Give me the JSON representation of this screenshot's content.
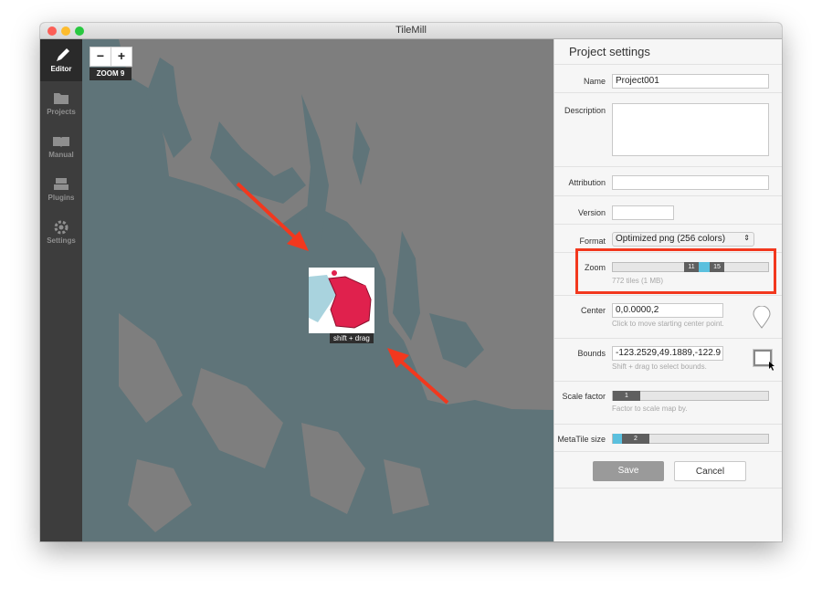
{
  "window": {
    "title": "TileMill"
  },
  "sidebar": {
    "items": [
      {
        "label": "Editor",
        "icon": "pencil-icon",
        "active": true
      },
      {
        "label": "Projects",
        "icon": "folder-icon"
      },
      {
        "label": "Manual",
        "icon": "book-icon"
      },
      {
        "label": "Plugins",
        "icon": "plugin-icon"
      },
      {
        "label": "Settings",
        "icon": "gear-icon"
      }
    ]
  },
  "map": {
    "zoom_out": "−",
    "zoom_in": "+",
    "zoom_label": "ZOOM 9",
    "drag_tooltip": "shift + drag"
  },
  "panel": {
    "title": "Project settings",
    "name_label": "Name",
    "name_value": "Project001",
    "description_label": "Description",
    "description_value": "",
    "attribution_label": "Attribution",
    "attribution_value": "",
    "version_label": "Version",
    "version_value": "",
    "format_label": "Format",
    "format_value": "Optimized png (256 colors)",
    "zoom_label": "Zoom",
    "zoom_min": "11",
    "zoom_max": "15",
    "zoom_hint": "772 tiles (1 MB)",
    "center_label": "Center",
    "center_value": "0,0.0000,2",
    "center_hint": "Click to move starting center point.",
    "bounds_label": "Bounds",
    "bounds_value": "-123.2529,49.1889,-122.9",
    "bounds_hint": "Shift + drag to select bounds.",
    "scale_label": "Scale factor",
    "scale_value": "1",
    "scale_hint": "Factor to scale map by.",
    "metatile_label": "MetaTile size",
    "metatile_value": "2",
    "save_label": "Save",
    "cancel_label": "Cancel"
  },
  "colors": {
    "water": "#5f7479",
    "land": "#7e7e7e",
    "accent_arrow": "#f2381e",
    "marker_red": "#e0214d",
    "slider_blue": "#5bc0de"
  }
}
